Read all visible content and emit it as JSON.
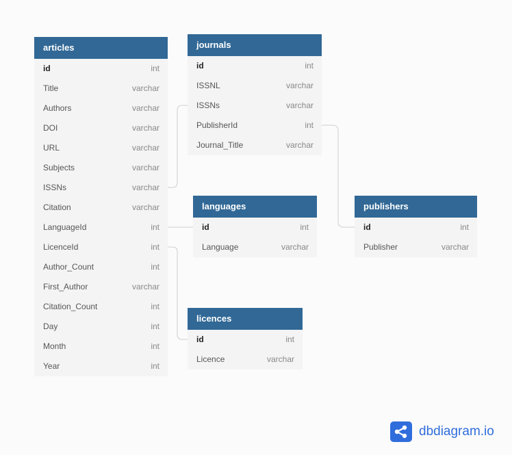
{
  "tables": {
    "articles": {
      "name": "articles",
      "fields": [
        {
          "name": "id",
          "type": "int",
          "pk": true
        },
        {
          "name": "Title",
          "type": "varchar"
        },
        {
          "name": "Authors",
          "type": "varchar"
        },
        {
          "name": "DOI",
          "type": "varchar"
        },
        {
          "name": "URL",
          "type": "varchar"
        },
        {
          "name": "Subjects",
          "type": "varchar"
        },
        {
          "name": "ISSNs",
          "type": "varchar"
        },
        {
          "name": "Citation",
          "type": "varchar"
        },
        {
          "name": "LanguageId",
          "type": "int"
        },
        {
          "name": "LicenceId",
          "type": "int"
        },
        {
          "name": "Author_Count",
          "type": "int"
        },
        {
          "name": "First_Author",
          "type": "varchar"
        },
        {
          "name": "Citation_Count",
          "type": "int"
        },
        {
          "name": "Day",
          "type": "int"
        },
        {
          "name": "Month",
          "type": "int"
        },
        {
          "name": "Year",
          "type": "int"
        }
      ]
    },
    "journals": {
      "name": "journals",
      "fields": [
        {
          "name": "id",
          "type": "int",
          "pk": true
        },
        {
          "name": "ISSNL",
          "type": "varchar"
        },
        {
          "name": "ISSNs",
          "type": "varchar"
        },
        {
          "name": "PublisherId",
          "type": "int"
        },
        {
          "name": "Journal_Title",
          "type": "varchar"
        }
      ]
    },
    "languages": {
      "name": "languages",
      "fields": [
        {
          "name": "id",
          "type": "int",
          "pk": true
        },
        {
          "name": "Language",
          "type": "varchar"
        }
      ]
    },
    "publishers": {
      "name": "publishers",
      "fields": [
        {
          "name": "id",
          "type": "int",
          "pk": true
        },
        {
          "name": "Publisher",
          "type": "varchar"
        }
      ]
    },
    "licences": {
      "name": "licences",
      "fields": [
        {
          "name": "id",
          "type": "int",
          "pk": true
        },
        {
          "name": "Licence",
          "type": "varchar"
        }
      ]
    }
  },
  "relations": [
    {
      "from": "articles.ISSNs",
      "to": "journals.ISSNs"
    },
    {
      "from": "articles.LanguageId",
      "to": "languages.id"
    },
    {
      "from": "articles.LicenceId",
      "to": "licences.id"
    },
    {
      "from": "journals.PublisherId",
      "to": "publishers.id"
    }
  ],
  "logo": {
    "text": "dbdiagram.io"
  },
  "colors": {
    "header": "#316896",
    "link": "#cccccc",
    "logo": "#2f6ddc"
  }
}
